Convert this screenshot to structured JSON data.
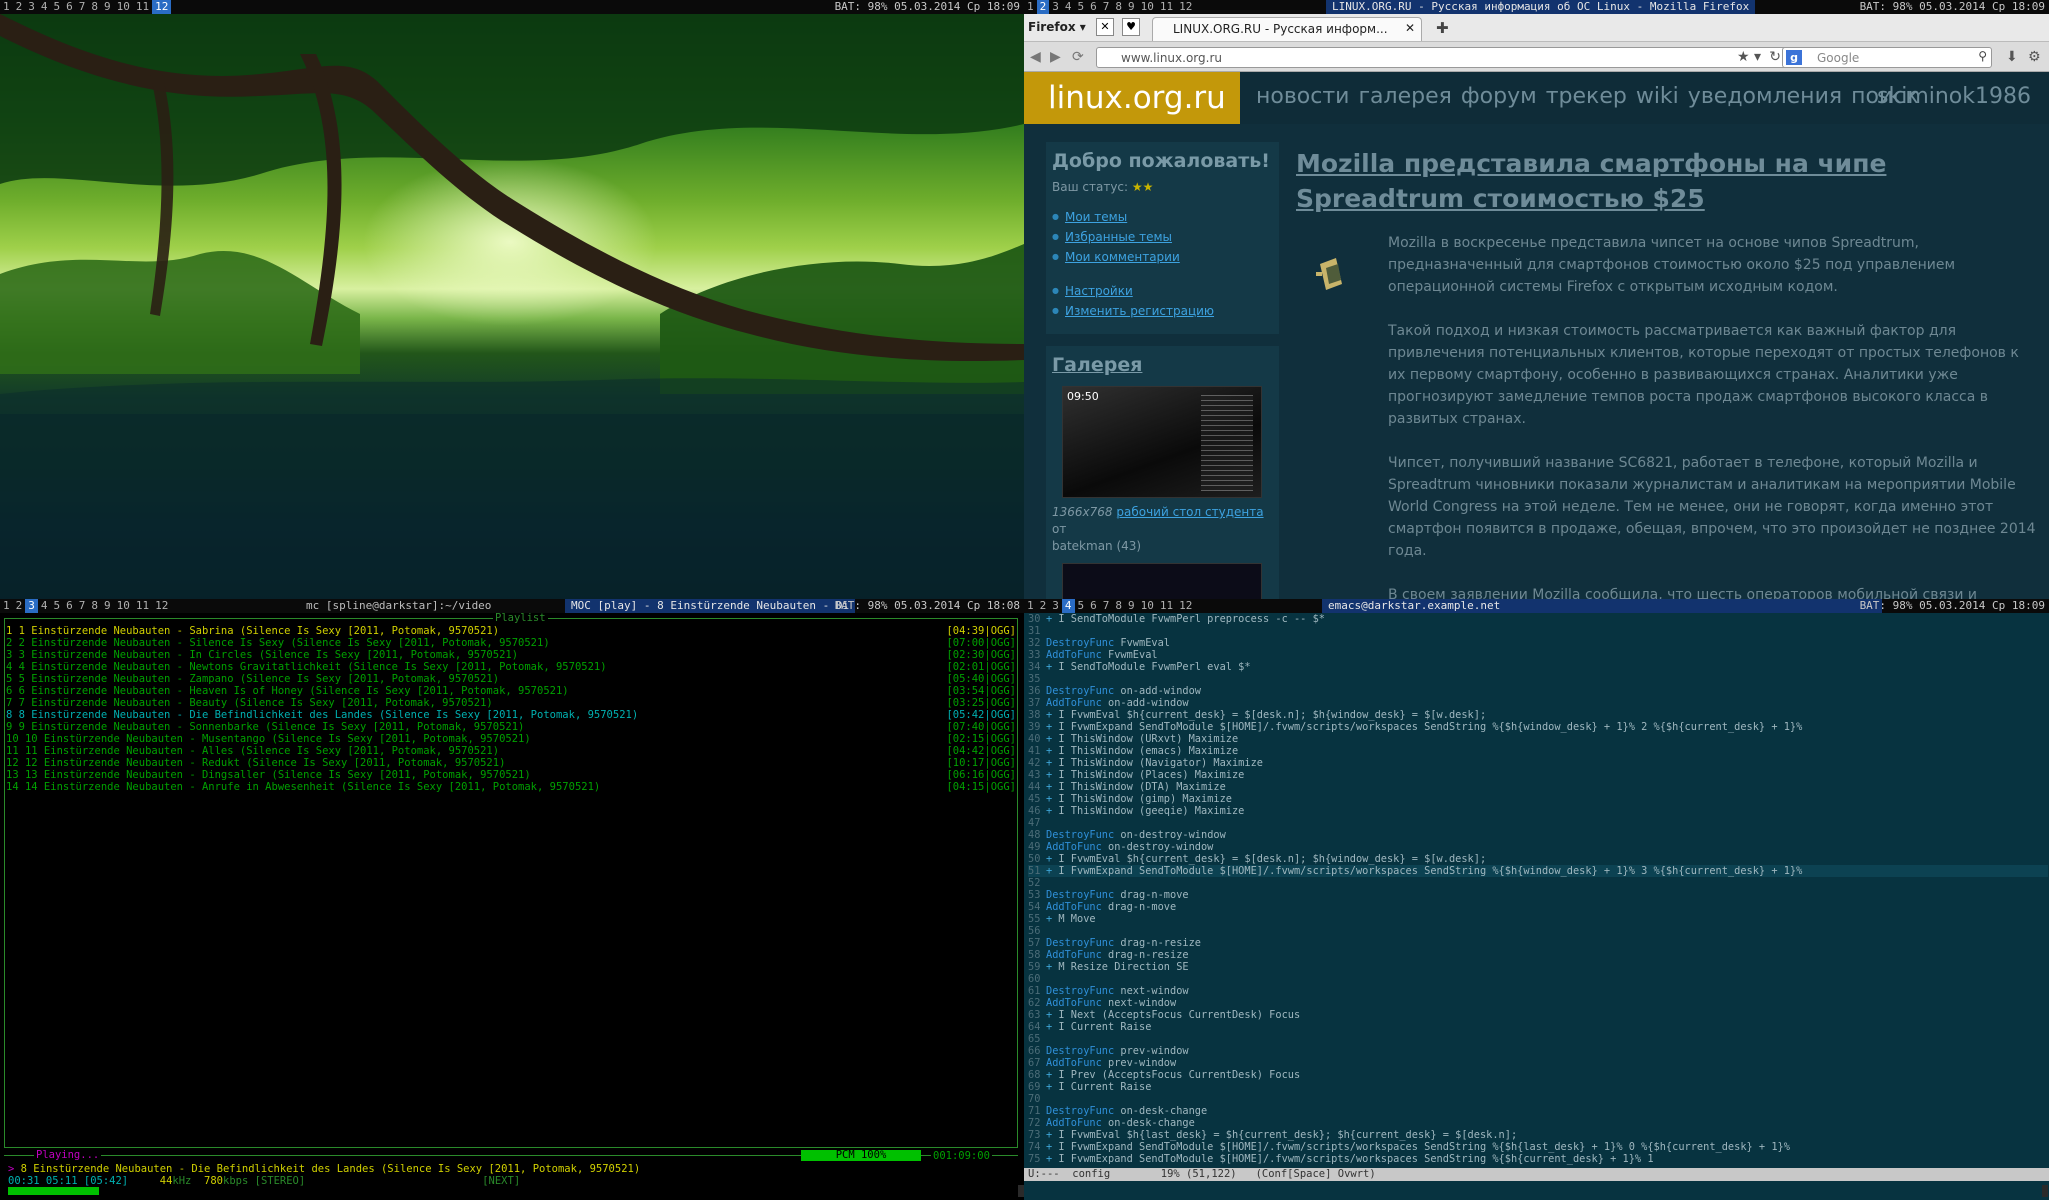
{
  "wm": {
    "top_left": {
      "workspaces": [
        "1",
        "2",
        "3",
        "4",
        "5",
        "6",
        "7",
        "8",
        "9",
        "10",
        "11",
        "12"
      ],
      "active": 11,
      "status": "BAT: 98% 05.03.2014 Ср 18:09"
    },
    "top_right": {
      "workspaces": [
        "1",
        "2",
        "3",
        "4",
        "5",
        "6",
        "7",
        "8",
        "9",
        "10",
        "11",
        "12"
      ],
      "active": 1,
      "title": "LINUX.ORG.RU - Русская информация об ОС Linux - Mozilla Firefox",
      "status": "BAT: 98% 05.03.2014 Ср 18:09"
    },
    "bottom_left": {
      "workspaces": [
        "1",
        "2",
        "3",
        "4",
        "5",
        "6",
        "7",
        "8",
        "9",
        "10",
        "11",
        "12"
      ],
      "active": 2,
      "title1": "mc [spline@darkstar]:~/video",
      "title2": "MOC [play] - 8 Einstürzende Neubauten - Di",
      "status": "BAT: 98% 05.03.2014 Ср 18:08"
    },
    "bottom_right": {
      "workspaces": [
        "1",
        "2",
        "3",
        "4",
        "5",
        "6",
        "7",
        "8",
        "9",
        "10",
        "11",
        "12"
      ],
      "active": 3,
      "title": "emacs@darkstar.example.net",
      "status": "BAT: 98% 05.03.2014 Ср 18:09"
    }
  },
  "firefox": {
    "menu_label": "Firefox",
    "tab_title": "LINUX.ORG.RU - Русская информ...",
    "url": "www.linux.org.ru",
    "search_placeholder": "Google",
    "site": {
      "logo": "linux.org.ru",
      "menu": [
        "новости",
        "галерея",
        "форум",
        "трекер",
        "wiki",
        "уведомления",
        "поиск"
      ],
      "user": "skiminok1986",
      "welcome_title": "Добро пожаловать!",
      "status_label": "Ваш статус:",
      "status_stars": "★★",
      "links1": [
        "Мои темы",
        "Избранные темы",
        "Мои комментарии"
      ],
      "links2": [
        "Настройки",
        "Изменить регистрацию"
      ],
      "gallery_title": "Галерея",
      "shot_time": "09:50",
      "caption_size": "1366x768",
      "caption_link": "рабочий стол студента",
      "caption_from": "от",
      "caption_author": "batekman (43)",
      "article_title": "Mozilla представила смартфоны на чипе Spreadtrum стоимостью $25",
      "paragraphs": [
        "Mozilla в воскресенье представила чипсет на основе чипов Spreadtrum, предназначенный для смартфонов стоимостью около $25 под управлением операционной системы Firefox с открытым исходным кодом.",
        "Такой подход и низкая стоимость рассматривается как важный фактор для привлечения потенциальных клиентов, которые переходят от простых телефонов к их первому смартфону, особенно в развивающихся странах. Аналитики уже прогнозируют замедление темпов роста продаж смартфонов высокого класса в развитых странах.",
        "Чипсет, получивший название SC6821, работает в телефоне, который Mozilla и Spreadtrum чиновники показали журналистам и аналитикам на мероприятии Mobile World Congress на этой неделе. Тем не менее, они не говорят, когда именно этот смартфон появится в продаже, обещая, впрочем, что это произойдет не позднее 2014 года.",
        "В своем заявлении Mozilla сообщила, что шесть операторов мобильной связи и"
      ]
    }
  },
  "moc": {
    "playlist_label": "Playlist",
    "tracks": [
      {
        "text": "1 1 Einstürzende Neubauten - Sabrina (Silence Is Sexy [2011, Potomak, 9570521)",
        "dur": "[04:39|OGG]"
      },
      {
        "text": "2 2 Einstürzende Neubauten - Silence Is Sexy (Silence Is Sexy [2011, Potomak, 9570521)",
        "dur": "[07:00|OGG]"
      },
      {
        "text": "3 3 Einstürzende Neubauten - In Circles (Silence Is Sexy [2011, Potomak, 9570521)",
        "dur": "[02:30|OGG]"
      },
      {
        "text": "4 4 Einstürzende Neubauten - Newtons Gravitatlichkeit (Silence Is Sexy [2011, Potomak, 9570521)",
        "dur": "[02:01|OGG]"
      },
      {
        "text": "5 5 Einstürzende Neubauten - Zampano (Silence Is Sexy [2011, Potomak, 9570521)",
        "dur": "[05:40|OGG]"
      },
      {
        "text": "6 6 Einstürzende Neubauten - Heaven Is of Honey (Silence Is Sexy [2011, Potomak, 9570521)",
        "dur": "[03:54|OGG]"
      },
      {
        "text": "7 7 Einstürzende Neubauten - Beauty (Silence Is Sexy [2011, Potomak, 9570521)",
        "dur": "[03:25|OGG]"
      },
      {
        "text": "8 8 Einstürzende Neubauten - Die Befindlichkeit des Landes (Silence Is Sexy [2011, Potomak, 9570521)",
        "dur": "[05:42|OGG]"
      },
      {
        "text": "9 9 Einstürzende Neubauten - Sonnenbarke (Silence Is Sexy [2011, Potomak, 9570521)",
        "dur": "[07:40|OGG]"
      },
      {
        "text": "10 10 Einstürzende Neubauten - Musentango (Silence Is Sexy [2011, Potomak, 9570521)",
        "dur": "[02:15|OGG]"
      },
      {
        "text": "11 11 Einstürzende Neubauten - Alles (Silence Is Sexy [2011, Potomak, 9570521)",
        "dur": "[04:42|OGG]"
      },
      {
        "text": "12 12 Einstürzende Neubauten - Redukt (Silence Is Sexy [2011, Potomak, 9570521)",
        "dur": "[10:17|OGG]"
      },
      {
        "text": "13 13 Einstürzende Neubauten - Dingsaller (Silence Is Sexy [2011, Potomak, 9570521)",
        "dur": "[06:16|OGG]"
      },
      {
        "text": "14 14 Einstürzende Neubauten - Anrufe in Abwesenheit (Silence Is Sexy [2011, Potomak, 9570521)",
        "dur": "[04:15|OGG]"
      }
    ],
    "playing_label": "Playing...",
    "pcm": "PCM 100%",
    "total_time": "001:09:00",
    "now_playing_mark": ">",
    "now_playing": "8 Einstürzende Neubauten - Die Befindlichkeit des Landes (Silence Is Sexy [2011, Potomak, 9570521)",
    "time_pos": "00:31 05:11",
    "time_total": "[05:42]",
    "khz": "44",
    "khz_label": "kHz",
    "kbps": "780",
    "kbps_label": "kbps",
    "stereo": "[STEREO]",
    "next": "[NEXT]",
    "progress": 0.09
  },
  "emacs": {
    "lines": [
      {
        "n": "30",
        "t": "+ I SendToModule FvwmPerl preprocess -c -- $*"
      },
      {
        "n": "31",
        "t": ""
      },
      {
        "n": "32",
        "k": "DestroyFunc",
        "t": " FvwmEval"
      },
      {
        "n": "33",
        "k": "AddToFunc",
        "t": " FvwmEval"
      },
      {
        "n": "34",
        "t": "+ I SendToModule FvwmPerl eval $*"
      },
      {
        "n": "35",
        "t": ""
      },
      {
        "n": "36",
        "k": "DestroyFunc",
        "t": " on-add-window"
      },
      {
        "n": "37",
        "k": "AddToFunc",
        "t": " on-add-window"
      },
      {
        "n": "38",
        "t": "+ I FvwmEval $h{current_desk} = $[desk.n]; $h{window_desk} = $[w.desk];"
      },
      {
        "n": "39",
        "t": "+ I FvwmExpand SendToModule $[HOME]/.fvwm/scripts/workspaces SendString %{$h{window_desk} + 1}% 2 %{$h{current_desk} + 1}%"
      },
      {
        "n": "40",
        "t": "+ I ThisWindow (URxvt) Maximize"
      },
      {
        "n": "41",
        "t": "+ I ThisWindow (emacs) Maximize"
      },
      {
        "n": "42",
        "t": "+ I ThisWindow (Navigator) Maximize"
      },
      {
        "n": "43",
        "t": "+ I ThisWindow (Places) Maximize"
      },
      {
        "n": "44",
        "t": "+ I ThisWindow (DTA) Maximize"
      },
      {
        "n": "45",
        "t": "+ I ThisWindow (gimp) Maximize"
      },
      {
        "n": "46",
        "t": "+ I ThisWindow (geeqie) Maximize"
      },
      {
        "n": "47",
        "t": ""
      },
      {
        "n": "48",
        "k": "DestroyFunc",
        "t": " on-destroy-window"
      },
      {
        "n": "49",
        "k": "AddToFunc",
        "t": " on-destroy-window"
      },
      {
        "n": "50",
        "t": "+ I FvwmEval $h{current_desk} = $[desk.n]; $h{window_desk} = $[w.desk];"
      },
      {
        "n": "51",
        "t": "+ I FvwmExpand SendToModule $[HOME]/.fvwm/scripts/workspaces SendString %{$h{window_desk} + 1}% 3 %{$h{current_desk} + 1}%",
        "hl": true
      },
      {
        "n": "52",
        "t": ""
      },
      {
        "n": "53",
        "k": "DestroyFunc",
        "t": " drag-n-move"
      },
      {
        "n": "54",
        "k": "AddToFunc",
        "t": " drag-n-move"
      },
      {
        "n": "55",
        "t": "+ M Move"
      },
      {
        "n": "56",
        "t": ""
      },
      {
        "n": "57",
        "k": "DestroyFunc",
        "t": " drag-n-resize"
      },
      {
        "n": "58",
        "k": "AddToFunc",
        "t": " drag-n-resize"
      },
      {
        "n": "59",
        "t": "+ M Resize Direction SE"
      },
      {
        "n": "60",
        "t": ""
      },
      {
        "n": "61",
        "k": "DestroyFunc",
        "t": " next-window"
      },
      {
        "n": "62",
        "k": "AddToFunc",
        "t": " next-window"
      },
      {
        "n": "63",
        "t": "+ I Next (AcceptsFocus CurrentDesk) Focus"
      },
      {
        "n": "64",
        "t": "+ I Current Raise"
      },
      {
        "n": "65",
        "t": ""
      },
      {
        "n": "66",
        "k": "DestroyFunc",
        "t": " prev-window"
      },
      {
        "n": "67",
        "k": "AddToFunc",
        "t": " prev-window"
      },
      {
        "n": "68",
        "t": "+ I Prev (AcceptsFocus CurrentDesk) Focus"
      },
      {
        "n": "69",
        "t": "+ I Current Raise"
      },
      {
        "n": "70",
        "t": ""
      },
      {
        "n": "71",
        "k": "DestroyFunc",
        "t": " on-desk-change"
      },
      {
        "n": "72",
        "k": "AddToFunc",
        "t": " on-desk-change"
      },
      {
        "n": "73",
        "t": "+ I FvwmEval $h{last_desk} = $h{current_desk}; $h{current_desk} = $[desk.n];"
      },
      {
        "n": "74",
        "t": "+ I FvwmExpand SendToModule $[HOME]/.fvwm/scripts/workspaces SendString %{$h{last_desk} + 1}% 0 %{$h{current_desk} + 1}%"
      },
      {
        "n": "75",
        "t": "+ I FvwmExpand SendToModule $[HOME]/.fvwm/scripts/workspaces SendString %{$h{current_desk} + 1}% 1"
      }
    ],
    "modeline": "U:---  config        19% (51,122)   (Conf[Space] Ovwrt)"
  }
}
